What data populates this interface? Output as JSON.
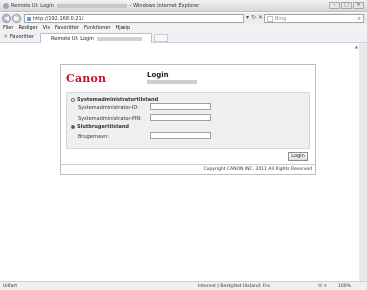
{
  "window": {
    "title_prefix": "Remote UI: Login",
    "title_suffix": "- Windows Internet Explorer",
    "min": "–",
    "max": "□",
    "close": "✕"
  },
  "address": {
    "url": "http://192.168.0.21/",
    "search_placeholder": "Bing",
    "back_glyph": "◀",
    "fwd_glyph": "▶",
    "refresh_glyph": "↻",
    "stop_glyph": "✕",
    "dropdown_glyph": "▾",
    "search_glyph": "⌕"
  },
  "menu": {
    "items": [
      "Filer",
      "Rediger",
      "Vis",
      "Favoritter",
      "Funktioner",
      "Hjælp"
    ]
  },
  "favorites": {
    "label": "Favoritter",
    "tab_label": "Remote UI: Login"
  },
  "login": {
    "logo": "Canon",
    "title": "Login",
    "admin_mode": "Systemadministratortilstand",
    "admin_id_label": "Systemadministrator-ID:",
    "admin_pin_label": "Systemadministrator-PIN:",
    "user_mode": "Slutbrugertilstand",
    "username_label": "Brugernavn:",
    "login_button": "Login",
    "copyright": "Copyright CANON INC. 2011 All Rights Reserved"
  },
  "status": {
    "left": "Udført",
    "zone": "Internet | Beskyttet tilstand: Fra",
    "zoom": "100%"
  }
}
